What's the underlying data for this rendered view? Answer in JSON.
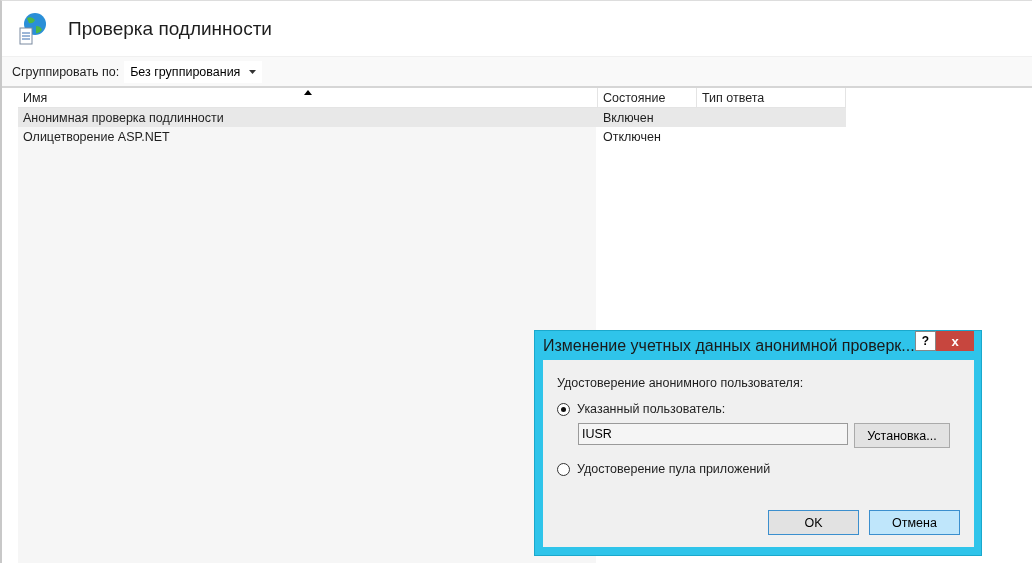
{
  "page": {
    "title": "Проверка подлинности"
  },
  "group_by": {
    "label": "Сгруппировать по:",
    "value": "Без группирования"
  },
  "table": {
    "columns": [
      {
        "label": "Имя",
        "sorted": true
      },
      {
        "label": "Состояние",
        "sorted": false
      },
      {
        "label": "Тип ответа",
        "sorted": false
      }
    ],
    "rows": [
      {
        "name": "Анонимная проверка подлинности",
        "state": "Включен",
        "selected": true
      },
      {
        "name": "Олицетворение ASP.NET",
        "state": "Отключен",
        "selected": false
      }
    ]
  },
  "dialog": {
    "title": "Изменение учетных данных анонимной проверк...",
    "help": "?",
    "close": "x",
    "group_label": "Удостоверение анонимного пользователя:",
    "options": [
      {
        "label": "Указанный пользователь:",
        "selected": true
      },
      {
        "label": "Удостоверение пула приложений",
        "selected": false
      }
    ],
    "user_value": "IUSR",
    "set_button": "Установка...",
    "buttons": [
      {
        "label": "OK",
        "kind": "default"
      },
      {
        "label": "Отмена",
        "kind": "hover"
      }
    ]
  }
}
